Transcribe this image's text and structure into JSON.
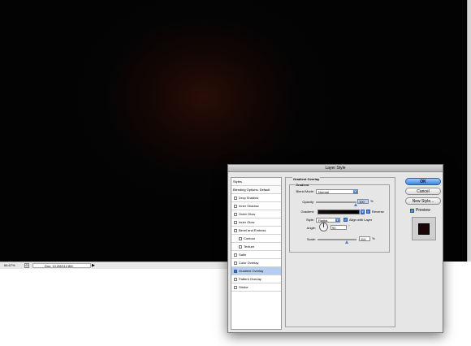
{
  "status": {
    "zoom": "66.67%",
    "doc_info": "Doc: 13.2M/112.8M"
  },
  "dialog": {
    "title": "Layer Style",
    "styles_list": [
      {
        "label": "Styles",
        "checkbox": false,
        "checked": false
      },
      {
        "label": "Blending Options: Default",
        "checkbox": false,
        "checked": false
      },
      {
        "label": "Drop Shadow",
        "checkbox": true,
        "checked": false
      },
      {
        "label": "Inner Shadow",
        "checkbox": true,
        "checked": false
      },
      {
        "label": "Outer Glow",
        "checkbox": true,
        "checked": false
      },
      {
        "label": "Inner Glow",
        "checkbox": true,
        "checked": false
      },
      {
        "label": "Bevel and Emboss",
        "checkbox": true,
        "checked": false
      },
      {
        "label": "Contour",
        "checkbox": true,
        "checked": false,
        "indent": true
      },
      {
        "label": "Texture",
        "checkbox": true,
        "checked": false,
        "indent": true
      },
      {
        "label": "Satin",
        "checkbox": true,
        "checked": false
      },
      {
        "label": "Color Overlay",
        "checkbox": true,
        "checked": false
      },
      {
        "label": "Gradient Overlay",
        "checkbox": true,
        "checked": true,
        "selected": true
      },
      {
        "label": "Pattern Overlay",
        "checkbox": true,
        "checked": false
      },
      {
        "label": "Stroke",
        "checkbox": true,
        "checked": false
      }
    ],
    "panel_title": "Gradient Overlay",
    "group_title": "Gradient",
    "blend_mode_label": "Blend Mode:",
    "blend_mode_value": "Normal",
    "opacity_label": "Opacity:",
    "opacity_value": "100",
    "opacity_unit": "%",
    "opacity_fraction": 1.0,
    "gradient_label": "Gradient:",
    "reverse_label": "Reverse",
    "reverse_checked": true,
    "style_label": "Style:",
    "style_value": "Radial",
    "align_label": "Align with Layer",
    "align_checked": true,
    "angle_label": "Angle:",
    "angle_value": "90",
    "angle_unit": "°",
    "scale_label": "Scale:",
    "scale_value": "114",
    "scale_unit": "%",
    "scale_fraction": 0.76,
    "buttons": {
      "ok": "OK",
      "cancel": "Cancel",
      "new_style": "New Style..."
    },
    "preview_label": "Preview",
    "preview_checked": true
  }
}
